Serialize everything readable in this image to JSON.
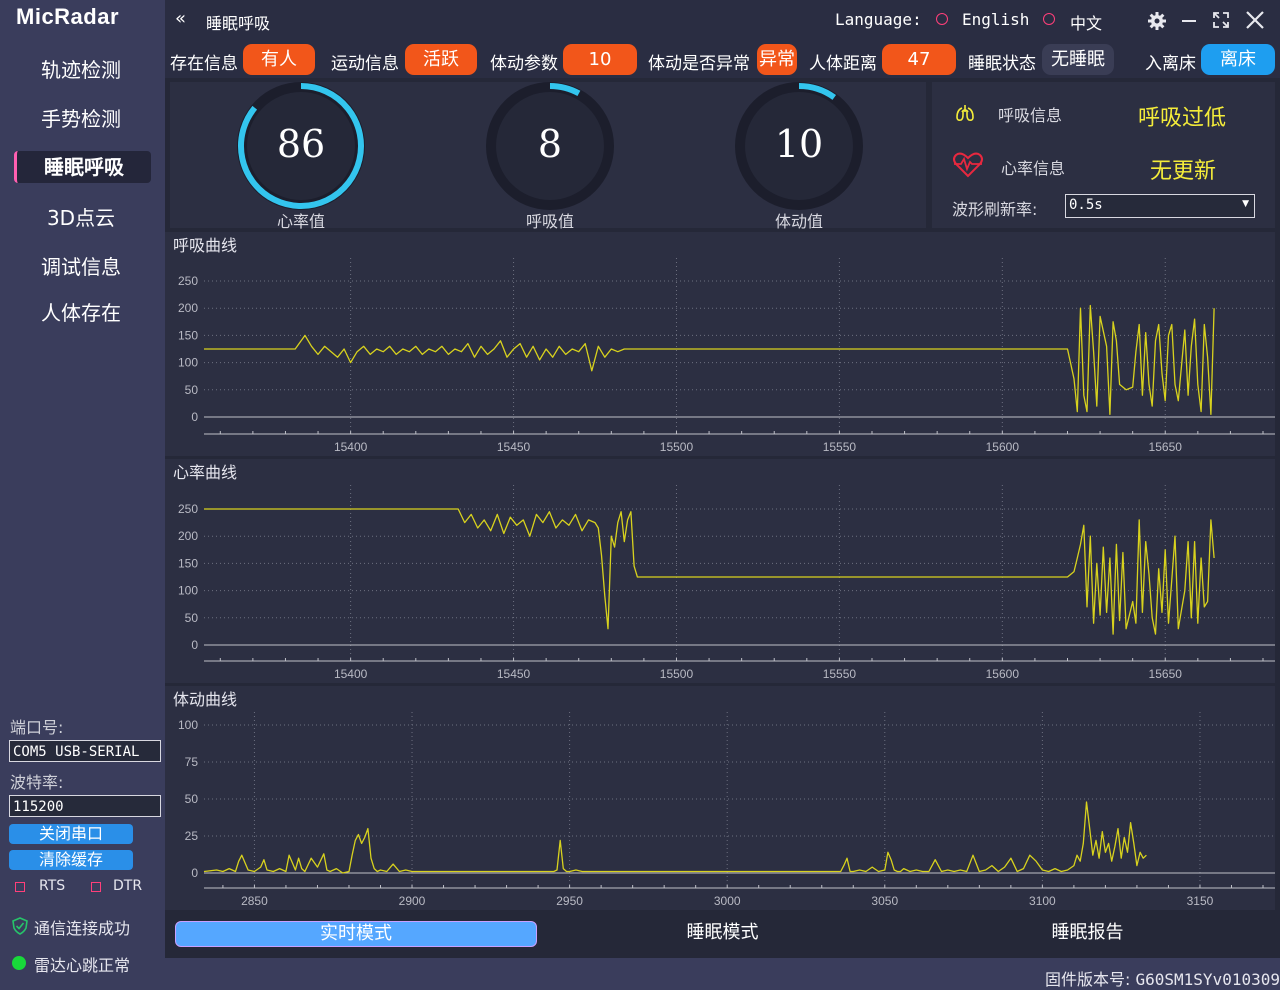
{
  "app": {
    "logo": "MicRadar",
    "title": "睡眠呼吸"
  },
  "sidebar": {
    "items": [
      {
        "label": "轨迹检测",
        "active": false
      },
      {
        "label": "手势检测",
        "active": false
      },
      {
        "label": "睡眠呼吸",
        "active": true
      },
      {
        "label": "3D点云",
        "active": false
      },
      {
        "label": "调试信息",
        "active": false
      },
      {
        "label": "人体存在",
        "active": false
      }
    ],
    "port_label": "端口号:",
    "port_value": "COM5 USB-SERIAL",
    "baud_label": "波特率:",
    "baud_value": "115200",
    "close_port_btn": "关闭串口",
    "clear_cache_btn": "清除缓存",
    "rts_label": "RTS",
    "dtr_label": "DTR",
    "comm_status": "通信连接成功",
    "radar_status": "雷达心跳正常"
  },
  "topbar": {
    "language_label": "Language:",
    "lang_en": "English",
    "lang_zh": "中文"
  },
  "status_bar": {
    "presence_label": "存在信息",
    "presence_value": "有人",
    "motion_label": "运动信息",
    "motion_value": "活跃",
    "body_param_label": "体动参数",
    "body_param_value": "10",
    "abnormal_label": "体动是否异常",
    "abnormal_value": "异常",
    "distance_label": "人体距离",
    "distance_value": "47",
    "sleep_state_label": "睡眠状态",
    "sleep_state_value": "无睡眠",
    "bed_label": "入离床",
    "bed_value": "离床"
  },
  "gauges": [
    {
      "value": "86",
      "label": "心率值",
      "fraction": 0.86
    },
    {
      "value": "8",
      "label": "呼吸值",
      "fraction": 0.08
    },
    {
      "value": "10",
      "label": "体动值",
      "fraction": 0.1
    }
  ],
  "info": {
    "breath_label": "呼吸信息",
    "breath_value": "呼吸过低",
    "heart_label": "心率信息",
    "heart_value": "无更新",
    "refresh_label": "波形刷新率:",
    "refresh_value": "0.5s"
  },
  "charts": {
    "breath": {
      "title": "呼吸曲线"
    },
    "heart": {
      "title": "心率曲线"
    },
    "motion": {
      "title": "体动曲线"
    }
  },
  "chart_data": [
    {
      "type": "line",
      "title": "呼吸曲线",
      "xlim": [
        15355,
        15680
      ],
      "ylim": [
        -5,
        265
      ],
      "xticks": [
        15400,
        15450,
        15500,
        15550,
        15600,
        15650
      ],
      "yticks": [
        0,
        50,
        100,
        150,
        200,
        250
      ],
      "series": [
        {
          "color": "#d8d21e",
          "x": [
            15355,
            15383,
            15386,
            15388,
            15390,
            15392,
            15394,
            15396,
            15398,
            15400,
            15402,
            15404,
            15406,
            15408,
            15410,
            15412,
            15414,
            15416,
            15418,
            15420,
            15422,
            15424,
            15426,
            15428,
            15430,
            15432,
            15434,
            15436,
            15438,
            15440,
            15442,
            15444,
            15446,
            15448,
            15450,
            15452,
            15454,
            15456,
            15458,
            15460,
            15462,
            15464,
            15466,
            15468,
            15470,
            15472,
            15474,
            15476,
            15478,
            15480,
            15482,
            15484,
            15486,
            15488,
            15620,
            15622,
            15623,
            15624,
            15625,
            15626,
            15627,
            15628,
            15629,
            15630,
            15632,
            15633,
            15634,
            15635,
            15636,
            15638,
            15640,
            15641,
            15642,
            15643,
            15644,
            15645,
            15646,
            15647,
            15648,
            15649,
            15650,
            15651,
            15652,
            15653,
            15654,
            15656,
            15657,
            15658,
            15659,
            15660,
            15661,
            15662,
            15663,
            15664,
            15665
          ],
          "y": [
            125,
            125,
            150,
            130,
            115,
            130,
            120,
            110,
            125,
            100,
            120,
            130,
            115,
            125,
            120,
            130,
            115,
            125,
            120,
            130,
            115,
            125,
            120,
            130,
            115,
            125,
            120,
            135,
            110,
            130,
            115,
            125,
            140,
            110,
            125,
            135,
            110,
            130,
            105,
            125,
            110,
            130,
            115,
            125,
            120,
            135,
            85,
            130,
            110,
            125,
            120,
            125,
            125,
            125,
            125,
            70,
            10,
            200,
            40,
            10,
            205,
            120,
            20,
            185,
            130,
            5,
            175,
            140,
            60,
            50,
            55,
            120,
            170,
            40,
            155,
            60,
            20,
            140,
            170,
            80,
            30,
            150,
            170,
            60,
            30,
            160,
            40,
            130,
            180,
            60,
            10,
            170,
            110,
            5,
            200
          ]
        }
      ]
    },
    {
      "type": "line",
      "title": "心率曲线",
      "xlim": [
        15355,
        15680
      ],
      "ylim": [
        -5,
        265
      ],
      "xticks": [
        15400,
        15450,
        15500,
        15550,
        15600,
        15650
      ],
      "yticks": [
        0,
        50,
        100,
        150,
        200,
        250
      ],
      "series": [
        {
          "color": "#d8d21e",
          "x": [
            15355,
            15433,
            15435,
            15437,
            15439,
            15441,
            15443,
            15445,
            15447,
            15449,
            15451,
            15453,
            15455,
            15457,
            15459,
            15461,
            15463,
            15465,
            15467,
            15469,
            15471,
            15473,
            15475,
            15476,
            15477,
            15478,
            15479,
            15480,
            15481,
            15482,
            15483,
            15484,
            15485,
            15486,
            15487,
            15488,
            15589,
            15620,
            15622,
            15623,
            15624,
            15625,
            15626,
            15627,
            15628,
            15629,
            15630,
            15631,
            15632,
            15633,
            15634,
            15635,
            15636,
            15637,
            15638,
            15640,
            15641,
            15642,
            15643,
            15644,
            15645,
            15646,
            15647,
            15648,
            15649,
            15650,
            15651,
            15652,
            15653,
            15654,
            15656,
            15657,
            15658,
            15659,
            15660,
            15661,
            15662,
            15663,
            15664,
            15665
          ],
          "y": [
            250,
            250,
            225,
            240,
            215,
            230,
            210,
            240,
            205,
            235,
            220,
            230,
            200,
            240,
            225,
            245,
            215,
            230,
            220,
            240,
            210,
            230,
            225,
            215,
            165,
            90,
            30,
            200,
            180,
            225,
            245,
            190,
            230,
            245,
            145,
            125,
            125,
            125,
            135,
            160,
            185,
            220,
            70,
            200,
            40,
            150,
            55,
            180,
            60,
            160,
            20,
            185,
            45,
            170,
            30,
            80,
            40,
            230,
            60,
            190,
            130,
            50,
            20,
            140,
            60,
            175,
            40,
            120,
            200,
            30,
            100,
            190,
            50,
            190,
            40,
            160,
            70,
            80,
            230,
            160
          ]
        }
      ]
    },
    {
      "type": "line",
      "title": "体动曲线",
      "xlim": [
        2834,
        3170
      ],
      "ylim": [
        -3,
        108
      ],
      "xticks": [
        2850,
        2900,
        2950,
        3000,
        3050,
        3100,
        3150
      ],
      "yticks": [
        0,
        25,
        50,
        75,
        100
      ],
      "series": [
        {
          "color": "#d8d21e",
          "x": [
            2834,
            2838,
            2840,
            2842,
            2844,
            2845,
            2846,
            2848,
            2850,
            2852,
            2853,
            2854,
            2856,
            2858,
            2860,
            2861,
            2862,
            2863,
            2864,
            2865,
            2866,
            2868,
            2870,
            2872,
            2873,
            2874,
            2876,
            2878,
            2880,
            2881,
            2882,
            2883,
            2884,
            2885,
            2886,
            2887,
            2888,
            2889,
            2890,
            2892,
            2894,
            2896,
            2898,
            2900,
            2910,
            2920,
            2930,
            2940,
            2945,
            2946,
            2947,
            2948,
            2949,
            2950,
            2952,
            2954,
            2960,
            2970,
            2980,
            2990,
            3000,
            3010,
            3020,
            3030,
            3036,
            3037,
            3038,
            3039,
            3040,
            3042,
            3044,
            3046,
            3048,
            3050,
            3051,
            3052,
            3053,
            3054,
            3055,
            3056,
            3058,
            3060,
            3062,
            3064,
            3066,
            3068,
            3070,
            3072,
            3074,
            3076,
            3078,
            3080,
            3082,
            3084,
            3086,
            3088,
            3090,
            3092,
            3094,
            3096,
            3098,
            3100,
            3102,
            3104,
            3106,
            3108,
            3110,
            3111,
            3112,
            3113,
            3114,
            3115,
            3116,
            3117,
            3118,
            3119,
            3120,
            3121,
            3122,
            3123,
            3124,
            3125,
            3126,
            3127,
            3128,
            3129,
            3130,
            3131,
            3132,
            3133
          ],
          "y": [
            1,
            2,
            1,
            3,
            1,
            8,
            12,
            2,
            1,
            4,
            9,
            2,
            1,
            3,
            1,
            12,
            7,
            2,
            10,
            3,
            1,
            10,
            4,
            13,
            2,
            1,
            3,
            0,
            1,
            12,
            22,
            26,
            20,
            24,
            30,
            10,
            3,
            1,
            2,
            1,
            6,
            1,
            2,
            1,
            1,
            1,
            1,
            1,
            1,
            2,
            22,
            3,
            1,
            1,
            2,
            1,
            1,
            1,
            1,
            1,
            1,
            1,
            1,
            1,
            1,
            5,
            10,
            1,
            1,
            2,
            1,
            4,
            1,
            2,
            14,
            9,
            2,
            1,
            1,
            3,
            1,
            2,
            1,
            1,
            9,
            1,
            2,
            1,
            2,
            1,
            12,
            1,
            2,
            5,
            1,
            4,
            10,
            1,
            3,
            12,
            8,
            2,
            1,
            3,
            1,
            2,
            5,
            12,
            8,
            20,
            48,
            30,
            12,
            22,
            10,
            28,
            14,
            20,
            8,
            18,
            30,
            10,
            24,
            14,
            34,
            20,
            5,
            14,
            10,
            12
          ]
        }
      ]
    }
  ]
}
